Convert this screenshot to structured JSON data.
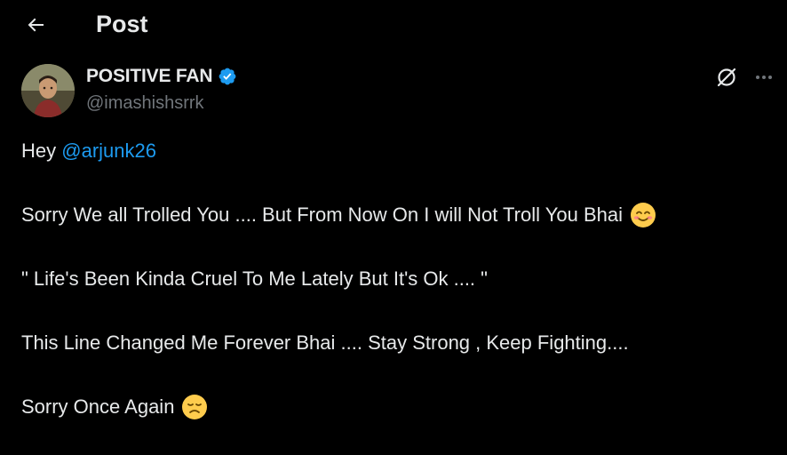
{
  "header": {
    "back_icon": "arrow-left-icon",
    "title": "Post"
  },
  "author": {
    "display_name": "POSITIVE FAN",
    "handle": "@imashishsrrk",
    "verified": true,
    "verified_color": "#1d9bf0",
    "avatar": "avatar"
  },
  "actions": {
    "grok_icon": "grok-icon",
    "more_icon": "more-dots-icon"
  },
  "tweet": {
    "line1_prefix": "Hey ",
    "mention": "@arjunk26",
    "line2": "Sorry We all Trolled You .... But From Now On I will Not Troll You Bhai",
    "line2_emoji": "smiling-face-icon",
    "line3": "\" Life's Been Kinda Cruel To Me Lately But It's Ok .... \"",
    "line4": "This Line Changed Me Forever Bhai .... Stay Strong , Keep Fighting....",
    "line5": "Sorry Once Again",
    "line5_emoji": "disappointed-face-icon"
  },
  "colors": {
    "background": "#000000",
    "text": "#e7e9ea",
    "secondary": "#71767b",
    "accent": "#1d9bf0"
  }
}
